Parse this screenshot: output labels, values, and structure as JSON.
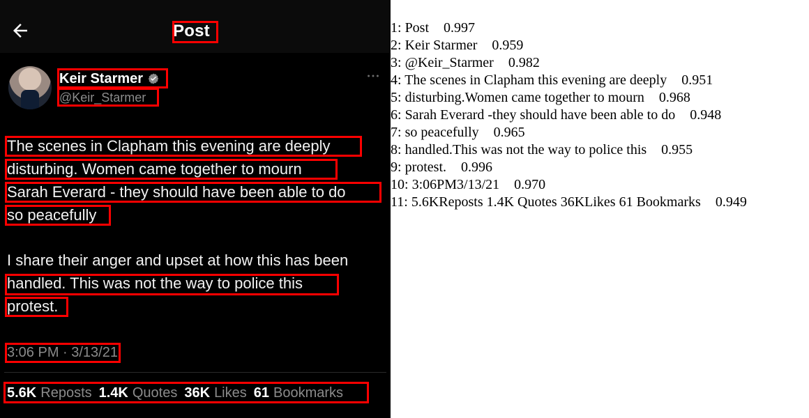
{
  "post_view": {
    "header": {
      "title": "Post"
    },
    "author": {
      "name": "Keir Starmer",
      "handle": "@Keir_Starmer"
    },
    "paragraph_1": [
      "The scenes in Clapham this evening are deeply",
      "disturbing. Women came together to mourn",
      "Sarah Everard  - they should have been able to do",
      "so peacefully"
    ],
    "paragraph_2": [
      "I share their anger and upset at how this has been",
      "handled. This was not the way to police this",
      "protest."
    ],
    "timestamp": "3:06 PM · 3/13/21",
    "stats": [
      {
        "num": "5.6K",
        "label": "Reposts"
      },
      {
        "num": "1.4K",
        "label": "Quotes"
      },
      {
        "num": "36K",
        "label": "Likes"
      },
      {
        "num": "61",
        "label": "Bookmarks"
      }
    ]
  },
  "ocr_results": [
    {
      "index": "1:",
      "text": "Post",
      "score": "0.997"
    },
    {
      "index": "2:",
      "text": "Keir Starmer",
      "score": "0.959"
    },
    {
      "index": "3:",
      "text": "@Keir_Starmer",
      "score": "0.982"
    },
    {
      "index": "4:",
      "text": "The scenes in Clapham this evening are deeply",
      "score": "0.951"
    },
    {
      "index": "5:",
      "text": "disturbing.Women came together to mourn",
      "score": "0.968"
    },
    {
      "index": "6:",
      "text": "Sarah Everard -they should have been able to do",
      "score": "0.948"
    },
    {
      "index": "7:",
      "text": "so peacefully",
      "score": "0.965"
    },
    {
      "index": "8:",
      "text": "handled.This was not the way to police this",
      "score": "0.955"
    },
    {
      "index": "9:",
      "text": "protest.",
      "score": "0.996"
    },
    {
      "index": "10:",
      "text": "3:06PM3/13/21",
      "score": "0.970"
    },
    {
      "index": "11:",
      "text": "5.6KReposts 1.4K Quotes 36KLikes 61 Bookmarks",
      "score": "0.949"
    }
  ],
  "colors": {
    "box": "#ff0000",
    "panel_bg": "#000000",
    "muted_text": "#8b8b8b"
  },
  "icons": [
    "back-arrow-icon",
    "verified-badge-icon",
    "more-options-icon"
  ]
}
